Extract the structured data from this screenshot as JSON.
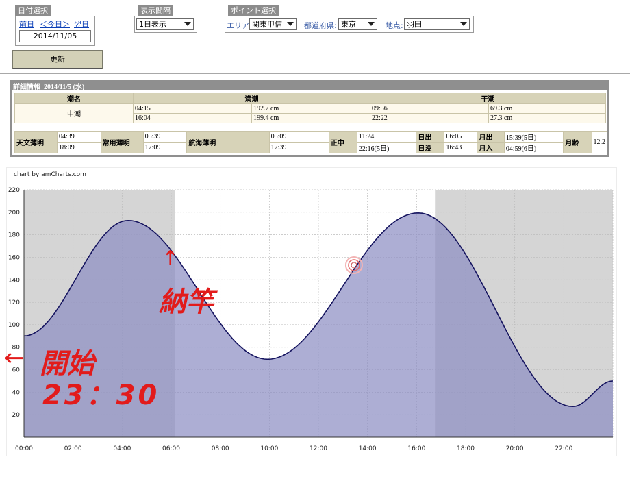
{
  "date_group": {
    "tab": "日付選択",
    "prev": "前日",
    "today": "＜今日＞",
    "next": "翌日",
    "date_value": "2014/11/05",
    "update_button": "更新"
  },
  "interval_group": {
    "tab": "表示間隔",
    "selected": "1日表示"
  },
  "point_group": {
    "tab": "ポイント選択",
    "area_label": "エリア:",
    "area_value": "関東甲信",
    "pref_label": "都道府県:",
    "pref_value": "東京",
    "point_label": "地点:",
    "point_value": "羽田"
  },
  "detail": {
    "title": "詳細情報  2014/11/5 (水)",
    "headers": {
      "tide_name": "潮名",
      "high": "満潮",
      "low": "干潮"
    },
    "tide_name": "中潮",
    "high_rows": [
      {
        "time": "04:15",
        "level": "192.7 cm"
      },
      {
        "time": "16:04",
        "level": "199.4 cm"
      }
    ],
    "low_rows": [
      {
        "time": "09:56",
        "level": "69.3 cm"
      },
      {
        "time": "22:22",
        "level": "27.3 cm"
      }
    ],
    "astro": [
      {
        "key": "天文薄明",
        "v1": "04:39",
        "v2": "18:09"
      },
      {
        "key": "常用薄明",
        "v1": "05:39",
        "v2": "17:09"
      },
      {
        "key": "航海薄明",
        "v1": "05:09",
        "v2": "17:39"
      },
      {
        "key": "正中",
        "v1": "11:24",
        "v2": "22:16(5日)"
      },
      {
        "key": "日出",
        "v1": "06:05",
        "key2": "日没",
        "v2": "16:43"
      },
      {
        "key": "月出",
        "v1": "15:39(5日)",
        "key2": "月入",
        "v2": "04:59(6日)"
      },
      {
        "key": "月齢",
        "v1": "12.2",
        "v2": ""
      }
    ]
  },
  "chart_credit": "chart by amCharts.com",
  "chart_data": {
    "type": "area",
    "y_ticks": [
      20,
      40,
      60,
      80,
      100,
      120,
      140,
      160,
      180,
      200,
      220
    ],
    "x_ticks": [
      "00:00",
      "02:00",
      "04:00",
      "06:00",
      "08:00",
      "10:00",
      "12:00",
      "14:00",
      "16:00",
      "18:00",
      "20:00",
      "22:00"
    ],
    "ylim": [
      0,
      220
    ],
    "xlim_hours": [
      0,
      24
    ],
    "night_bands_hours": [
      [
        0,
        6.15
      ],
      [
        16.75,
        24
      ]
    ],
    "extrema": [
      {
        "t": 0,
        "v": 90
      },
      {
        "t": 4.25,
        "v": 192.7
      },
      {
        "t": 9.93,
        "v": 69.3
      },
      {
        "t": 16.07,
        "v": 199.4
      },
      {
        "t": 22.37,
        "v": 27.3
      },
      {
        "t": 24,
        "v": 50
      }
    ],
    "grid": true,
    "line_color": "#15145f",
    "fill_color": "#8e8fc4",
    "band_color": "#d5d5d5"
  },
  "annotations": {
    "finish": "納竿",
    "start": "開始",
    "start_time": "23：30",
    "up_arrow": "↑",
    "left_arrow": "←"
  }
}
